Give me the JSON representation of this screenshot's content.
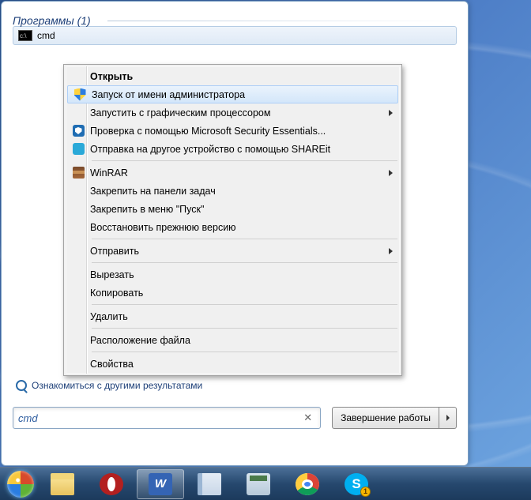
{
  "start_menu": {
    "section_header": "Программы (1)",
    "result": {
      "label": "cmd"
    },
    "see_more": "Ознакомиться с другими результатами",
    "search_value": "cmd",
    "shutdown_label": "Завершение работы"
  },
  "context_menu": {
    "items": [
      {
        "label": "Открыть",
        "bold": true
      },
      {
        "label": "Запуск от имени администратора",
        "icon": "shield",
        "highlight": true
      },
      {
        "label": "Запустить с графическим процессором",
        "submenu": true
      },
      {
        "label": "Проверка с помощью Microsoft Security Essentials...",
        "icon": "mse"
      },
      {
        "label": "Отправка на другое устройство с помощью SHAREit",
        "icon": "shareit"
      },
      {
        "sep": true
      },
      {
        "label": "WinRAR",
        "icon": "winrar",
        "submenu": true
      },
      {
        "label": "Закрепить на панели задач"
      },
      {
        "label": "Закрепить в меню \"Пуск\""
      },
      {
        "label": "Восстановить прежнюю версию"
      },
      {
        "sep": true
      },
      {
        "label": "Отправить",
        "submenu": true
      },
      {
        "sep": true
      },
      {
        "label": "Вырезать"
      },
      {
        "label": "Копировать"
      },
      {
        "sep": true
      },
      {
        "label": "Удалить"
      },
      {
        "sep": true
      },
      {
        "label": "Расположение файла"
      },
      {
        "sep": true
      },
      {
        "label": "Свойства"
      }
    ]
  },
  "taskbar": {
    "items": [
      {
        "name": "start",
        "icon": "start-orb"
      },
      {
        "name": "explorer",
        "icon": "tb-explorer"
      },
      {
        "name": "opera",
        "icon": "tb-opera"
      },
      {
        "name": "word",
        "icon": "tb-word",
        "letter": "W",
        "active": true
      },
      {
        "name": "notepad",
        "icon": "tb-notepad"
      },
      {
        "name": "calculator",
        "icon": "tb-calc"
      },
      {
        "name": "chrome",
        "icon": "tb-chrome"
      },
      {
        "name": "skype",
        "icon": "tb-skype",
        "letter": "S",
        "badge": "1"
      }
    ]
  }
}
